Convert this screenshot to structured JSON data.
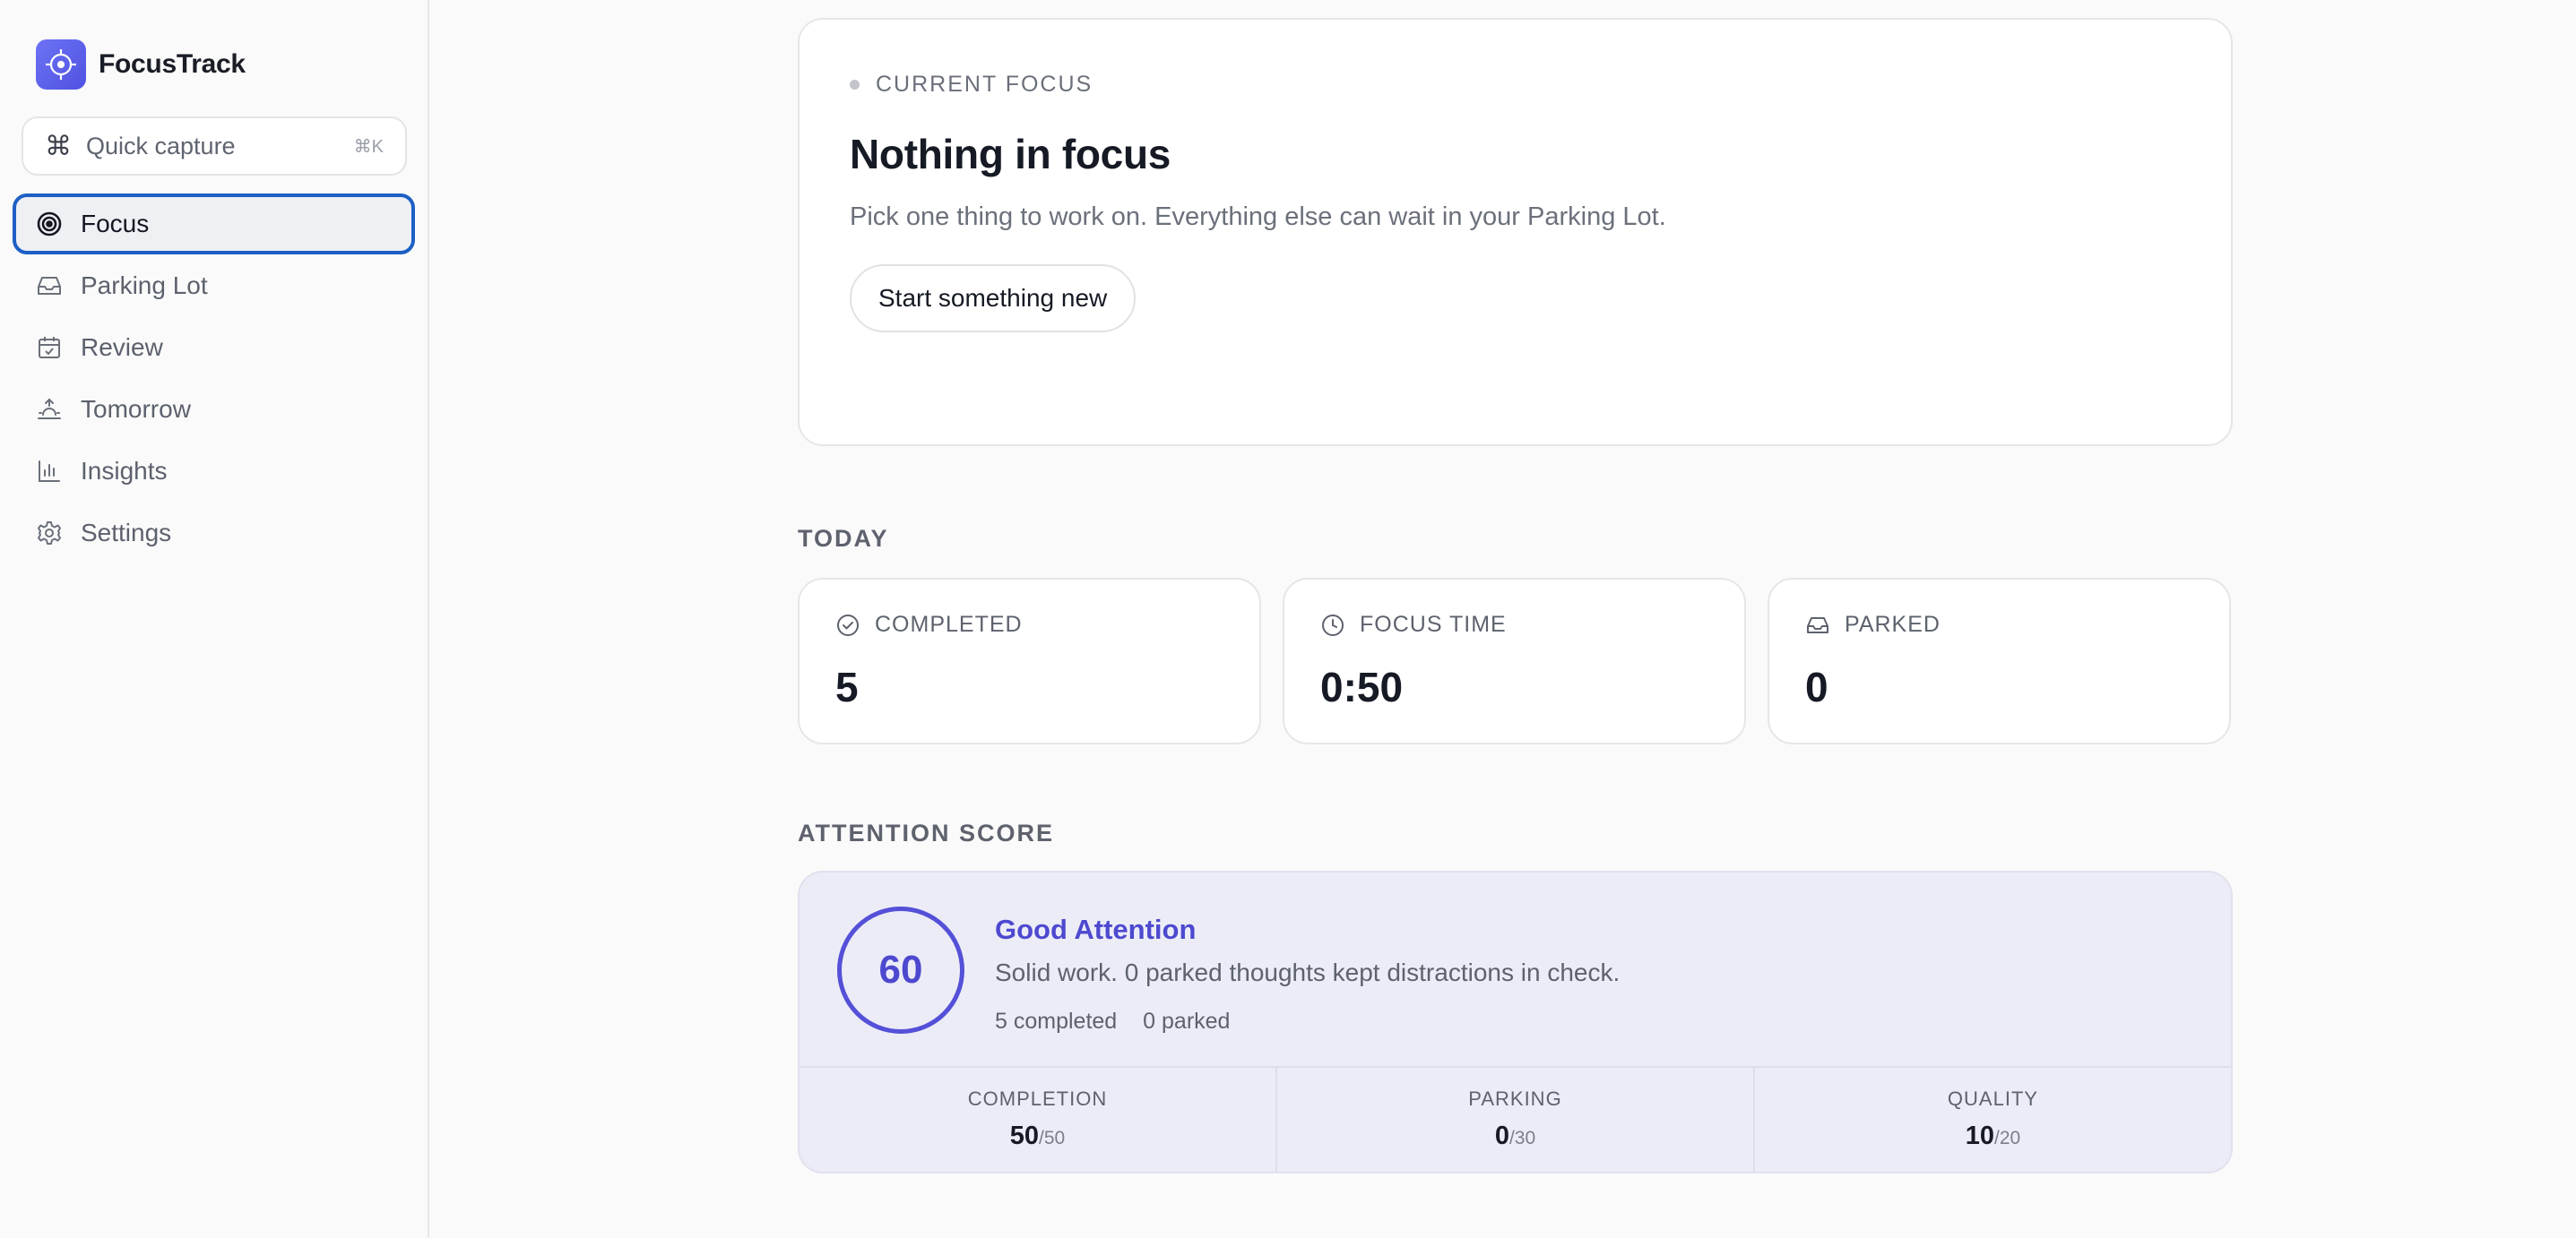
{
  "app": {
    "name": "FocusTrack"
  },
  "sidebar": {
    "quick_capture": {
      "label": "Quick capture",
      "shortcut": "⌘K",
      "icon": "command-icon"
    },
    "items": [
      {
        "label": "Focus",
        "icon": "target-icon",
        "active": true
      },
      {
        "label": "Parking Lot",
        "icon": "inbox-icon",
        "active": false
      },
      {
        "label": "Review",
        "icon": "calendar-check-icon",
        "active": false
      },
      {
        "label": "Tomorrow",
        "icon": "sunrise-icon",
        "active": false
      },
      {
        "label": "Insights",
        "icon": "bar-chart-icon",
        "active": false
      },
      {
        "label": "Settings",
        "icon": "gear-icon",
        "active": false
      }
    ]
  },
  "current_focus": {
    "label": "CURRENT FOCUS",
    "title": "Nothing in focus",
    "description": "Pick one thing to work on. Everything else can wait in your Parking Lot.",
    "button": "Start something new"
  },
  "today": {
    "title": "TODAY",
    "stats": [
      {
        "label": "COMPLETED",
        "value": "5",
        "icon": "check-circle-icon"
      },
      {
        "label": "FOCUS TIME",
        "value": "0:50",
        "icon": "clock-icon"
      },
      {
        "label": "PARKED",
        "value": "0",
        "icon": "inbox-icon"
      }
    ]
  },
  "attention": {
    "title": "ATTENTION SCORE",
    "score": "60",
    "heading": "Good Attention",
    "description": "Solid work. 0 parked thoughts kept distractions in check.",
    "completed_meta": "5 completed",
    "parked_meta": "0 parked",
    "breakdown": [
      {
        "label": "COMPLETION",
        "value": "50",
        "max": "/50"
      },
      {
        "label": "PARKING",
        "value": "0",
        "max": "/30"
      },
      {
        "label": "QUALITY",
        "value": "10",
        "max": "/20"
      }
    ]
  },
  "colors": {
    "accent": "#4d49cf",
    "active_outline": "#1d5fc4",
    "attention_bg": "#ececf7"
  }
}
